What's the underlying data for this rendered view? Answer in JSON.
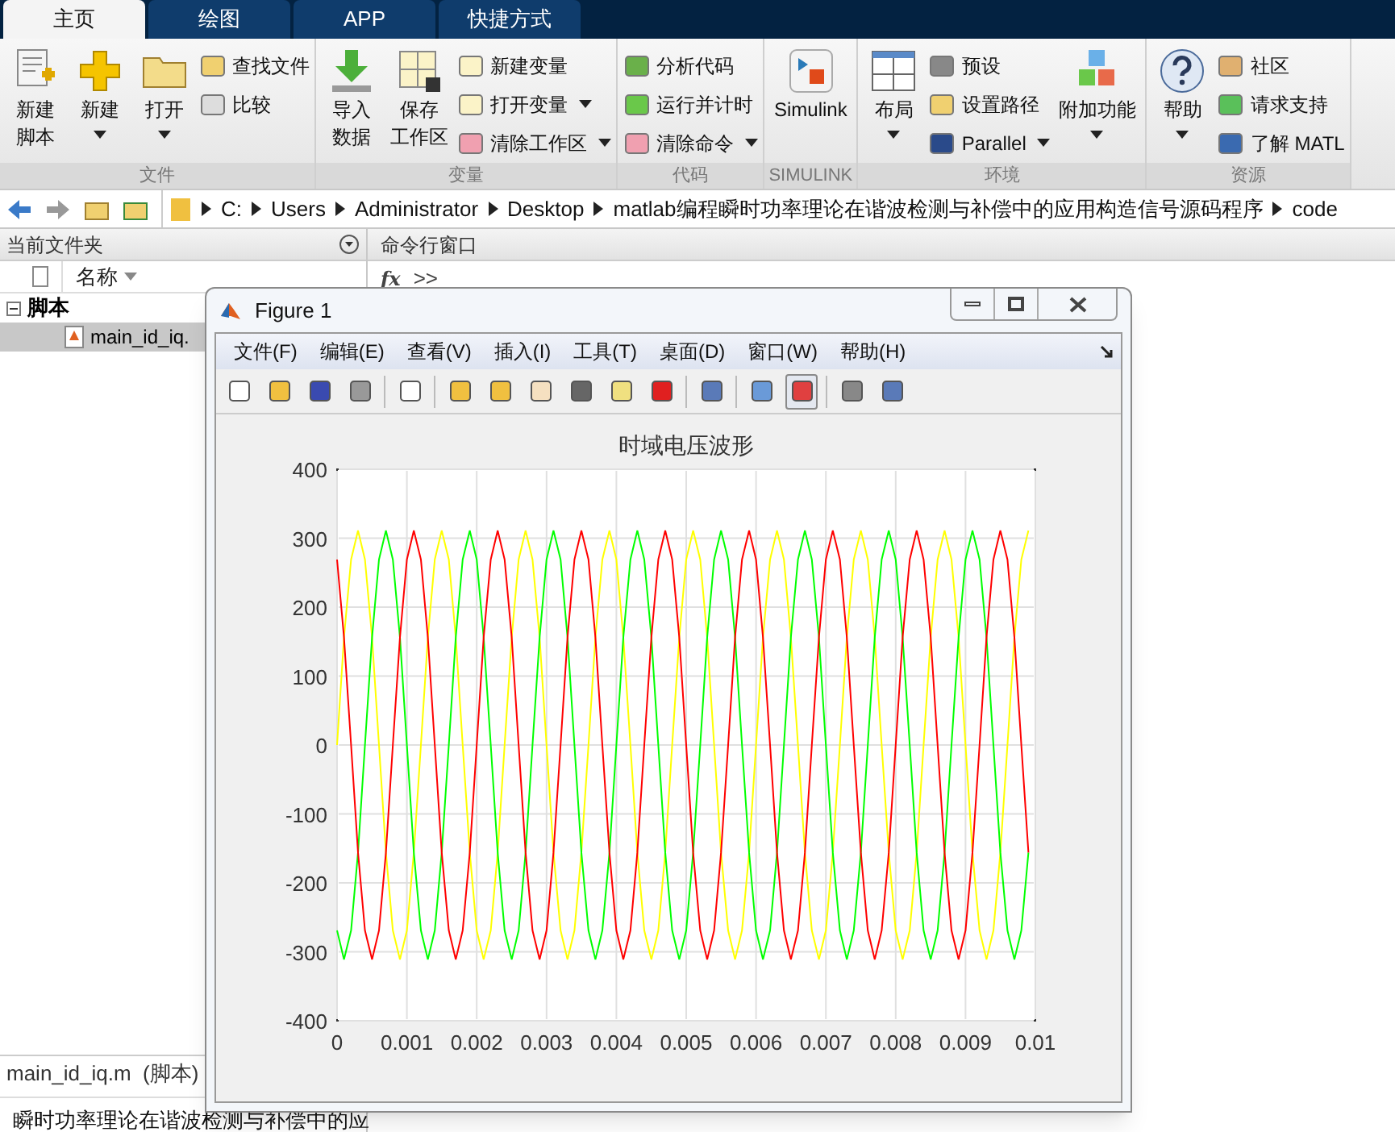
{
  "tabs": [
    {
      "label": "主页",
      "selected": true
    },
    {
      "label": "绘图",
      "selected": false
    },
    {
      "label": "APP",
      "selected": false
    },
    {
      "label": "快捷方式",
      "selected": false
    }
  ],
  "ribbon": [
    {
      "label": "文件",
      "columns": [
        {
          "kind": "large",
          "lines": [
            "新建",
            "脚本"
          ],
          "caret": false
        },
        {
          "kind": "large",
          "lines": [
            "新建"
          ],
          "caret": true
        },
        {
          "kind": "large",
          "lines": [
            "打开"
          ],
          "caret": true
        },
        {
          "kind": "stack",
          "items": [
            {
              "label": "查找文件",
              "caret": false
            },
            {
              "label": "比较",
              "caret": false
            }
          ]
        }
      ]
    },
    {
      "label": "变量",
      "columns": [
        {
          "kind": "large",
          "lines": [
            "导入",
            "数据"
          ],
          "caret": false
        },
        {
          "kind": "large",
          "lines": [
            "保存",
            "工作区"
          ],
          "caret": false
        },
        {
          "kind": "stack",
          "items": [
            {
              "label": "新建变量",
              "caret": false
            },
            {
              "label": "打开变量",
              "caret": true
            },
            {
              "label": "清除工作区",
              "caret": true
            }
          ]
        }
      ]
    },
    {
      "label": "代码",
      "columns": [
        {
          "kind": "stack",
          "items": [
            {
              "label": "分析代码",
              "caret": false
            },
            {
              "label": "运行并计时",
              "caret": false
            },
            {
              "label": "清除命令",
              "caret": true
            }
          ]
        }
      ]
    },
    {
      "label": "SIMULINK",
      "columns": [
        {
          "kind": "large",
          "lines": [
            "Simulink"
          ],
          "caret": false
        }
      ]
    },
    {
      "label": "环境",
      "columns": [
        {
          "kind": "large",
          "lines": [
            "布局"
          ],
          "caret": true
        },
        {
          "kind": "stack",
          "items": [
            {
              "label": "预设",
              "caret": false
            },
            {
              "label": "设置路径",
              "caret": false
            },
            {
              "label": "Parallel",
              "caret": true
            }
          ]
        },
        {
          "kind": "large",
          "lines": [
            "附加功能"
          ],
          "caret": true
        }
      ]
    },
    {
      "label": "资源",
      "columns": [
        {
          "kind": "large",
          "lines": [
            "帮助"
          ],
          "caret": true
        },
        {
          "kind": "stack",
          "items": [
            {
              "label": "社区",
              "caret": false
            },
            {
              "label": "请求支持",
              "caret": false
            },
            {
              "label": "了解 MATL",
              "caret": false
            }
          ]
        }
      ]
    }
  ],
  "path": [
    "C:",
    "Users",
    "Administrator",
    "Desktop",
    "matlab编程瞬时功率理论在谐波检测与补偿中的应用构造信号源码程序",
    "code"
  ],
  "current_folder": {
    "title": "当前文件夹",
    "column": "名称",
    "tree": [
      {
        "label": "脚本",
        "expanded": true,
        "children": [
          {
            "label": "main_id_iq.",
            "selected": true
          }
        ]
      }
    ],
    "details_title": "main_id_iq.m  (脚本)",
    "details_text": "瞬时功率理论在谐波检测与补偿中的应"
  },
  "command_window": {
    "title": "命令行窗口",
    "icon_text": "fx",
    "prompt": ">>"
  },
  "figure": {
    "title": "Figure 1",
    "menu": [
      "文件(F)",
      "编辑(E)",
      "查看(V)",
      "插入(I)",
      "工具(T)",
      "桌面(D)",
      "窗口(W)",
      "帮助(H)"
    ],
    "legend_button_on": true,
    "chart_data": {
      "type": "line",
      "title": "时域电压波形",
      "x": [
        0,
        0.0001,
        0.0002,
        0.0003,
        0.0004,
        0.0005,
        0.0006,
        0.0007,
        0.0008,
        0.0009,
        0.001,
        0.0011,
        0.0012,
        0.0013,
        0.0014,
        0.0015,
        0.0016,
        0.0017,
        0.0018,
        0.0019,
        0.002,
        0.0021,
        0.0022,
        0.0023,
        0.0024,
        0.0025,
        0.0026,
        0.0027,
        0.0028,
        0.0029,
        0.003,
        0.0031,
        0.0032,
        0.0033,
        0.0034,
        0.0035,
        0.0036,
        0.0037,
        0.0038,
        0.0039,
        0.004,
        0.0041,
        0.0042,
        0.0043,
        0.0044,
        0.0045,
        0.0046,
        0.0047,
        0.0048,
        0.0049,
        0.005,
        0.0051,
        0.0052,
        0.0053,
        0.0054,
        0.0055,
        0.0056,
        0.0057,
        0.0058,
        0.0059,
        0.006,
        0.0061,
        0.0062,
        0.0063,
        0.0064,
        0.0065,
        0.0066,
        0.0067,
        0.0068,
        0.0069,
        0.007,
        0.0071,
        0.0072,
        0.0073,
        0.0074,
        0.0075,
        0.0076,
        0.0077,
        0.0078,
        0.0079,
        0.008,
        0.0081,
        0.0082,
        0.0083,
        0.0084,
        0.0085,
        0.0086,
        0.0087,
        0.0088,
        0.0089,
        0.009,
        0.0091,
        0.0092,
        0.0093,
        0.0094,
        0.0095,
        0.0096,
        0.0097,
        0.0098,
        0.0099
      ],
      "series": [
        {
          "color": "#ffff00",
          "values": [
            0,
            156,
            269,
            311,
            269,
            156,
            0,
            -156,
            -269,
            -311,
            -269,
            -156,
            0,
            156,
            269,
            311,
            269,
            156,
            0,
            -156,
            -269,
            -311,
            -269,
            -156,
            0,
            156,
            269,
            311,
            269,
            156,
            0,
            -156,
            -269,
            -311,
            -269,
            -156,
            0,
            156,
            269,
            311,
            269,
            156,
            0,
            -156,
            -269,
            -311,
            -269,
            -156,
            0,
            156,
            269,
            311,
            269,
            156,
            0,
            -156,
            -269,
            -311,
            -269,
            -156,
            0,
            156,
            269,
            311,
            269,
            156,
            0,
            -156,
            -269,
            -311,
            -269,
            -156,
            0,
            156,
            269,
            311,
            269,
            156,
            0,
            -156,
            -269,
            -311,
            -269,
            -156,
            0,
            156,
            269,
            311,
            269,
            156,
            0,
            -156,
            -269,
            -311,
            -269,
            -156,
            0,
            156,
            269,
            311
          ]
        },
        {
          "color": "#00ff00",
          "values": [
            -269,
            -311,
            -269,
            -156,
            0,
            156,
            269,
            311,
            269,
            156,
            0,
            -156,
            -269,
            -311,
            -269,
            -156,
            0,
            156,
            269,
            311,
            269,
            156,
            0,
            -156,
            -269,
            -311,
            -269,
            -156,
            0,
            156,
            269,
            311,
            269,
            156,
            0,
            -156,
            -269,
            -311,
            -269,
            -156,
            0,
            156,
            269,
            311,
            269,
            156,
            0,
            -156,
            -269,
            -311,
            -269,
            -156,
            0,
            156,
            269,
            311,
            269,
            156,
            0,
            -156,
            -269,
            -311,
            -269,
            -156,
            0,
            156,
            269,
            311,
            269,
            156,
            0,
            -156,
            -269,
            -311,
            -269,
            -156,
            0,
            156,
            269,
            311,
            269,
            156,
            0,
            -156,
            -269,
            -311,
            -269,
            -156,
            0,
            156,
            269,
            311,
            269,
            156,
            0,
            -156,
            -269,
            -311,
            -269,
            -156
          ]
        },
        {
          "color": "#ff0000",
          "values": [
            269,
            156,
            0,
            -156,
            -269,
            -311,
            -269,
            -156,
            0,
            156,
            269,
            311,
            269,
            156,
            0,
            -156,
            -269,
            -311,
            -269,
            -156,
            0,
            156,
            269,
            311,
            269,
            156,
            0,
            -156,
            -269,
            -311,
            -269,
            -156,
            0,
            156,
            269,
            311,
            269,
            156,
            0,
            -156,
            -269,
            -311,
            -269,
            -156,
            0,
            156,
            269,
            311,
            269,
            156,
            0,
            -156,
            -269,
            -311,
            -269,
            -156,
            0,
            156,
            269,
            311,
            269,
            156,
            0,
            -156,
            -269,
            -311,
            -269,
            -156,
            0,
            156,
            269,
            311,
            269,
            156,
            0,
            -156,
            -269,
            -311,
            -269,
            -156,
            0,
            156,
            269,
            311,
            269,
            156,
            0,
            -156,
            -269,
            -311,
            -269,
            -156,
            0,
            156,
            269,
            311,
            269,
            156,
            0,
            -156
          ]
        }
      ],
      "grid": true,
      "xlim": [
        0,
        0.01
      ],
      "ylim": [
        -400,
        400
      ],
      "xticks": [
        0,
        {
          "value": 0.001,
          "label": "0.001"
        },
        {
          "value": 0.002,
          "label": "0.002"
        },
        {
          "value": 0.003,
          "label": "0.003"
        },
        {
          "value": 0.004,
          "label": "0.004"
        },
        {
          "value": 0.005,
          "label": "0.005"
        },
        {
          "value": 0.006,
          "label": "0.006"
        },
        {
          "value": 0.007,
          "label": "0.007"
        },
        {
          "value": 0.008,
          "label": "0.008"
        },
        {
          "value": 0.009,
          "label": "0.009"
        },
        {
          "value": 0.01,
          "label": "0.01"
        }
      ],
      "yticks": [
        -400,
        -300,
        -200,
        -100,
        0,
        100,
        200,
        300,
        400
      ]
    }
  }
}
